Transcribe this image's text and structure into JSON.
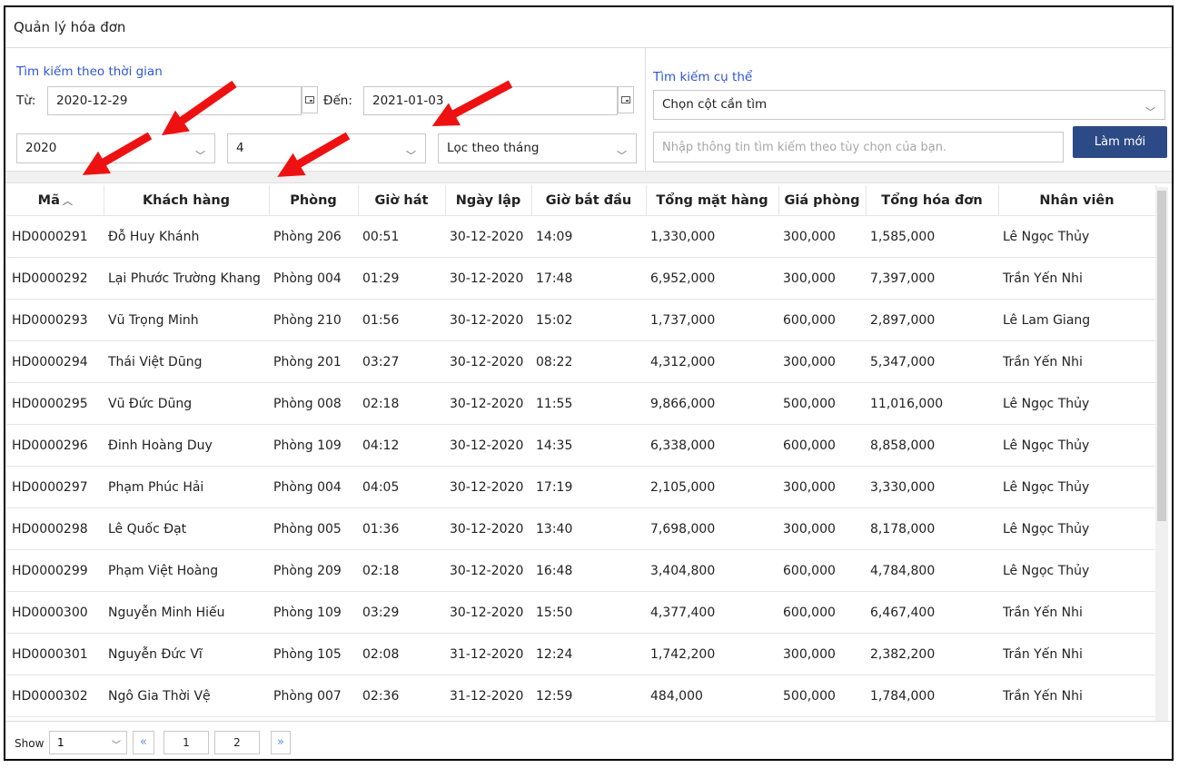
{
  "window": {
    "title": "Quản lý hóa đơn"
  },
  "time_search": {
    "section_label": "Tìm kiếm theo thời gian",
    "from_label": "Từ:",
    "from_value": "2020-12-29",
    "to_label": "Đến:",
    "to_value": "2021-01-03",
    "year_value": "2020",
    "month_value": "4",
    "filter_value": "Lọc theo tháng"
  },
  "specific_search": {
    "section_label": "Tìm kiếm cụ thể",
    "column_select_value": "Chọn cột cần tìm",
    "search_placeholder": "Nhập thông tin tìm kiếm theo tùy chọn của bạn.",
    "refresh_label": "Làm mới"
  },
  "table": {
    "headers": [
      "Mã",
      "Khách hàng",
      "Phòng",
      "Giờ hát",
      "Ngày lập",
      "Giờ bắt đầu",
      "Tổng mặt hàng",
      "Giá phòng",
      "Tổng hóa đơn",
      "Nhân viên"
    ],
    "sort_indicator": "︿",
    "rows": [
      [
        "HD0000291",
        "Đỗ Huy Khánh",
        "Phòng 206",
        "00:51",
        "30-12-2020",
        "14:09",
        "1,330,000",
        "300,000",
        "1,585,000",
        "Lê Ngọc Thủy"
      ],
      [
        "HD0000292",
        "Lại Phước Trường Khang",
        "Phòng 004",
        "01:29",
        "30-12-2020",
        "17:48",
        "6,952,000",
        "300,000",
        "7,397,000",
        "Trần Yến Nhi"
      ],
      [
        "HD0000293",
        "Vũ Trọng Minh",
        "Phòng 210",
        "01:56",
        "30-12-2020",
        "15:02",
        "1,737,000",
        "600,000",
        "2,897,000",
        "Lê Lam Giang"
      ],
      [
        "HD0000294",
        "Thái Việt Dũng",
        "Phòng 201",
        "03:27",
        "30-12-2020",
        "08:22",
        "4,312,000",
        "300,000",
        "5,347,000",
        "Trần Yến Nhi"
      ],
      [
        "HD0000295",
        "Vũ Đức Dũng",
        "Phòng 008",
        "02:18",
        "30-12-2020",
        "11:55",
        "9,866,000",
        "500,000",
        "11,016,000",
        "Lê Ngọc Thủy"
      ],
      [
        "HD0000296",
        "Đinh Hoàng Duy",
        "Phòng 109",
        "04:12",
        "30-12-2020",
        "14:35",
        "6,338,000",
        "600,000",
        "8,858,000",
        "Lê Ngọc Thủy"
      ],
      [
        "HD0000297",
        "Phạm Phúc Hải",
        "Phòng 004",
        "04:05",
        "30-12-2020",
        "17:19",
        "2,105,000",
        "300,000",
        "3,330,000",
        "Lê Ngọc Thủy"
      ],
      [
        "HD0000298",
        "Lê Quốc Đạt",
        "Phòng 005",
        "01:36",
        "30-12-2020",
        "13:40",
        "7,698,000",
        "300,000",
        "8,178,000",
        "Lê Ngọc Thủy"
      ],
      [
        "HD0000299",
        "Phạm Việt Hoàng",
        "Phòng 209",
        "02:18",
        "30-12-2020",
        "16:48",
        "3,404,800",
        "600,000",
        "4,784,800",
        "Lê Ngọc Thủy"
      ],
      [
        "HD0000300",
        "Nguyễn Minh Hiếu",
        "Phòng 109",
        "03:29",
        "30-12-2020",
        "15:50",
        "4,377,400",
        "600,000",
        "6,467,400",
        "Trần Yến Nhi"
      ],
      [
        "HD0000301",
        "Nguyễn Đức Vĩ",
        "Phòng 105",
        "02:08",
        "31-12-2020",
        "12:24",
        "1,742,200",
        "300,000",
        "2,382,200",
        "Trần Yến Nhi"
      ],
      [
        "HD0000302",
        "Ngô Gia Thời Vệ",
        "Phòng 007",
        "02:36",
        "31-12-2020",
        "12:59",
        "484,000",
        "500,000",
        "1,784,000",
        "Trần Yến Nhi"
      ]
    ]
  },
  "pagination": {
    "show_label": "Show",
    "show_value": "1",
    "first_icon": "«",
    "pages": [
      "1",
      "2"
    ],
    "last_icon": "»"
  },
  "colors": {
    "accent_blue": "#2f55d4",
    "button_bg": "#2c4a86",
    "annotation_arrow": "#ee1111"
  }
}
